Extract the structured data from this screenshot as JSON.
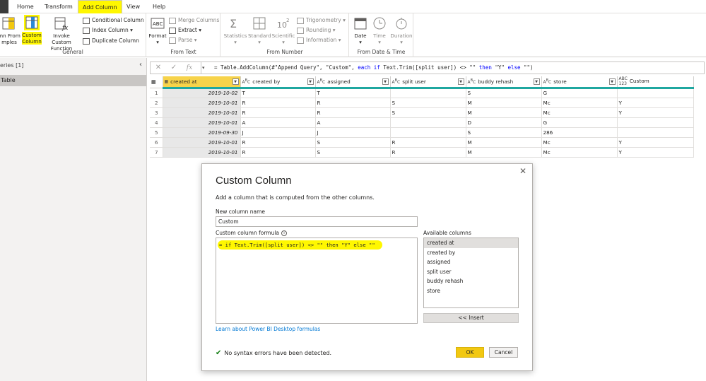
{
  "tabs": [
    "Home",
    "Transform",
    "Add Column",
    "View",
    "Help"
  ],
  "ribbon": {
    "general": {
      "label": "General",
      "column_from_examples": [
        "mn From",
        "mples"
      ],
      "custom_column": [
        "Custom",
        "Column"
      ],
      "invoke_custom_function": [
        "Invoke Custom",
        "Function"
      ],
      "conditional_column": "Conditional Column",
      "index_column": "Index Column",
      "duplicate_column": "Duplicate Column"
    },
    "from_text": {
      "label": "From Text",
      "format": "Format",
      "merge_columns": "Merge Columns",
      "extract": "Extract",
      "parse": "Parse"
    },
    "from_number": {
      "label": "From Number",
      "statistics": "Statistics",
      "standard": "Standard",
      "scientific": "Scientific",
      "trigonometry": "Trigonometry",
      "rounding": "Rounding",
      "information": "Information"
    },
    "from_date_time": {
      "label": "From Date & Time",
      "date": "Date",
      "time": "Time",
      "duration": "Duration"
    }
  },
  "queries": {
    "title": "eries [1]",
    "items": [
      "Table"
    ]
  },
  "formula_bar": {
    "prefix": "= Table.AddColumn(#\"Append Query\", \"Custom\", ",
    "kw_each": "each",
    "kw_if": "if",
    "middle": " Text.Trim([split user]) <> \"\" ",
    "kw_then": "then",
    "then_val": " \"Y\" ",
    "kw_else": "else",
    "tail": " \"\")"
  },
  "grid": {
    "columns": [
      {
        "type": "date",
        "name": "created at"
      },
      {
        "type": "ABC",
        "name": "created by"
      },
      {
        "type": "ABC",
        "name": "assigned"
      },
      {
        "type": "ABC",
        "name": "split user"
      },
      {
        "type": "ABC",
        "name": "buddy rehash"
      },
      {
        "type": "ABC",
        "name": "store"
      },
      {
        "type": "ABC123",
        "name": "Custom"
      }
    ],
    "rows": [
      [
        "1",
        "2019-10-02",
        "T",
        "T",
        "",
        "S",
        "G",
        ""
      ],
      [
        "2",
        "2019-10-01",
        "R",
        "R",
        "S",
        "M",
        "Mc",
        "Y"
      ],
      [
        "3",
        "2019-10-01",
        "R",
        "R",
        "S",
        "M",
        "Mc",
        "Y"
      ],
      [
        "4",
        "2019-10-01",
        "A",
        "A",
        "",
        "D",
        "G",
        ""
      ],
      [
        "5",
        "2019-09-30",
        "J",
        "J",
        "",
        "S",
        "286",
        ""
      ],
      [
        "6",
        "2019-10-01",
        "R",
        "S",
        "R",
        "M",
        "Mc",
        "Y"
      ],
      [
        "7",
        "2019-10-01",
        "R",
        "S",
        "R",
        "M",
        "Mc",
        "Y"
      ]
    ]
  },
  "dialog": {
    "title": "Custom Column",
    "description": "Add a column that is computed from the other columns.",
    "name_label": "New column name",
    "name_value": "Custom",
    "formula_label": "Custom column formula",
    "formula_value": "= if Text.Trim([split user]) <> \"\" then \"Y\" else \"\"",
    "available_label": "Available columns",
    "available_columns": [
      "created at",
      "created by",
      "assigned",
      "split user",
      "buddy rehash",
      "store"
    ],
    "insert_label": "<< Insert",
    "learn_link": "Learn about Power BI Desktop formulas",
    "status": "No syntax errors have been detected.",
    "ok": "OK",
    "cancel": "Cancel"
  },
  "colors": {
    "highlight": "#fff700",
    "accent_teal": "#1fa7a0",
    "ok_yellow": "#f2c811",
    "link_blue": "#0078d4"
  }
}
